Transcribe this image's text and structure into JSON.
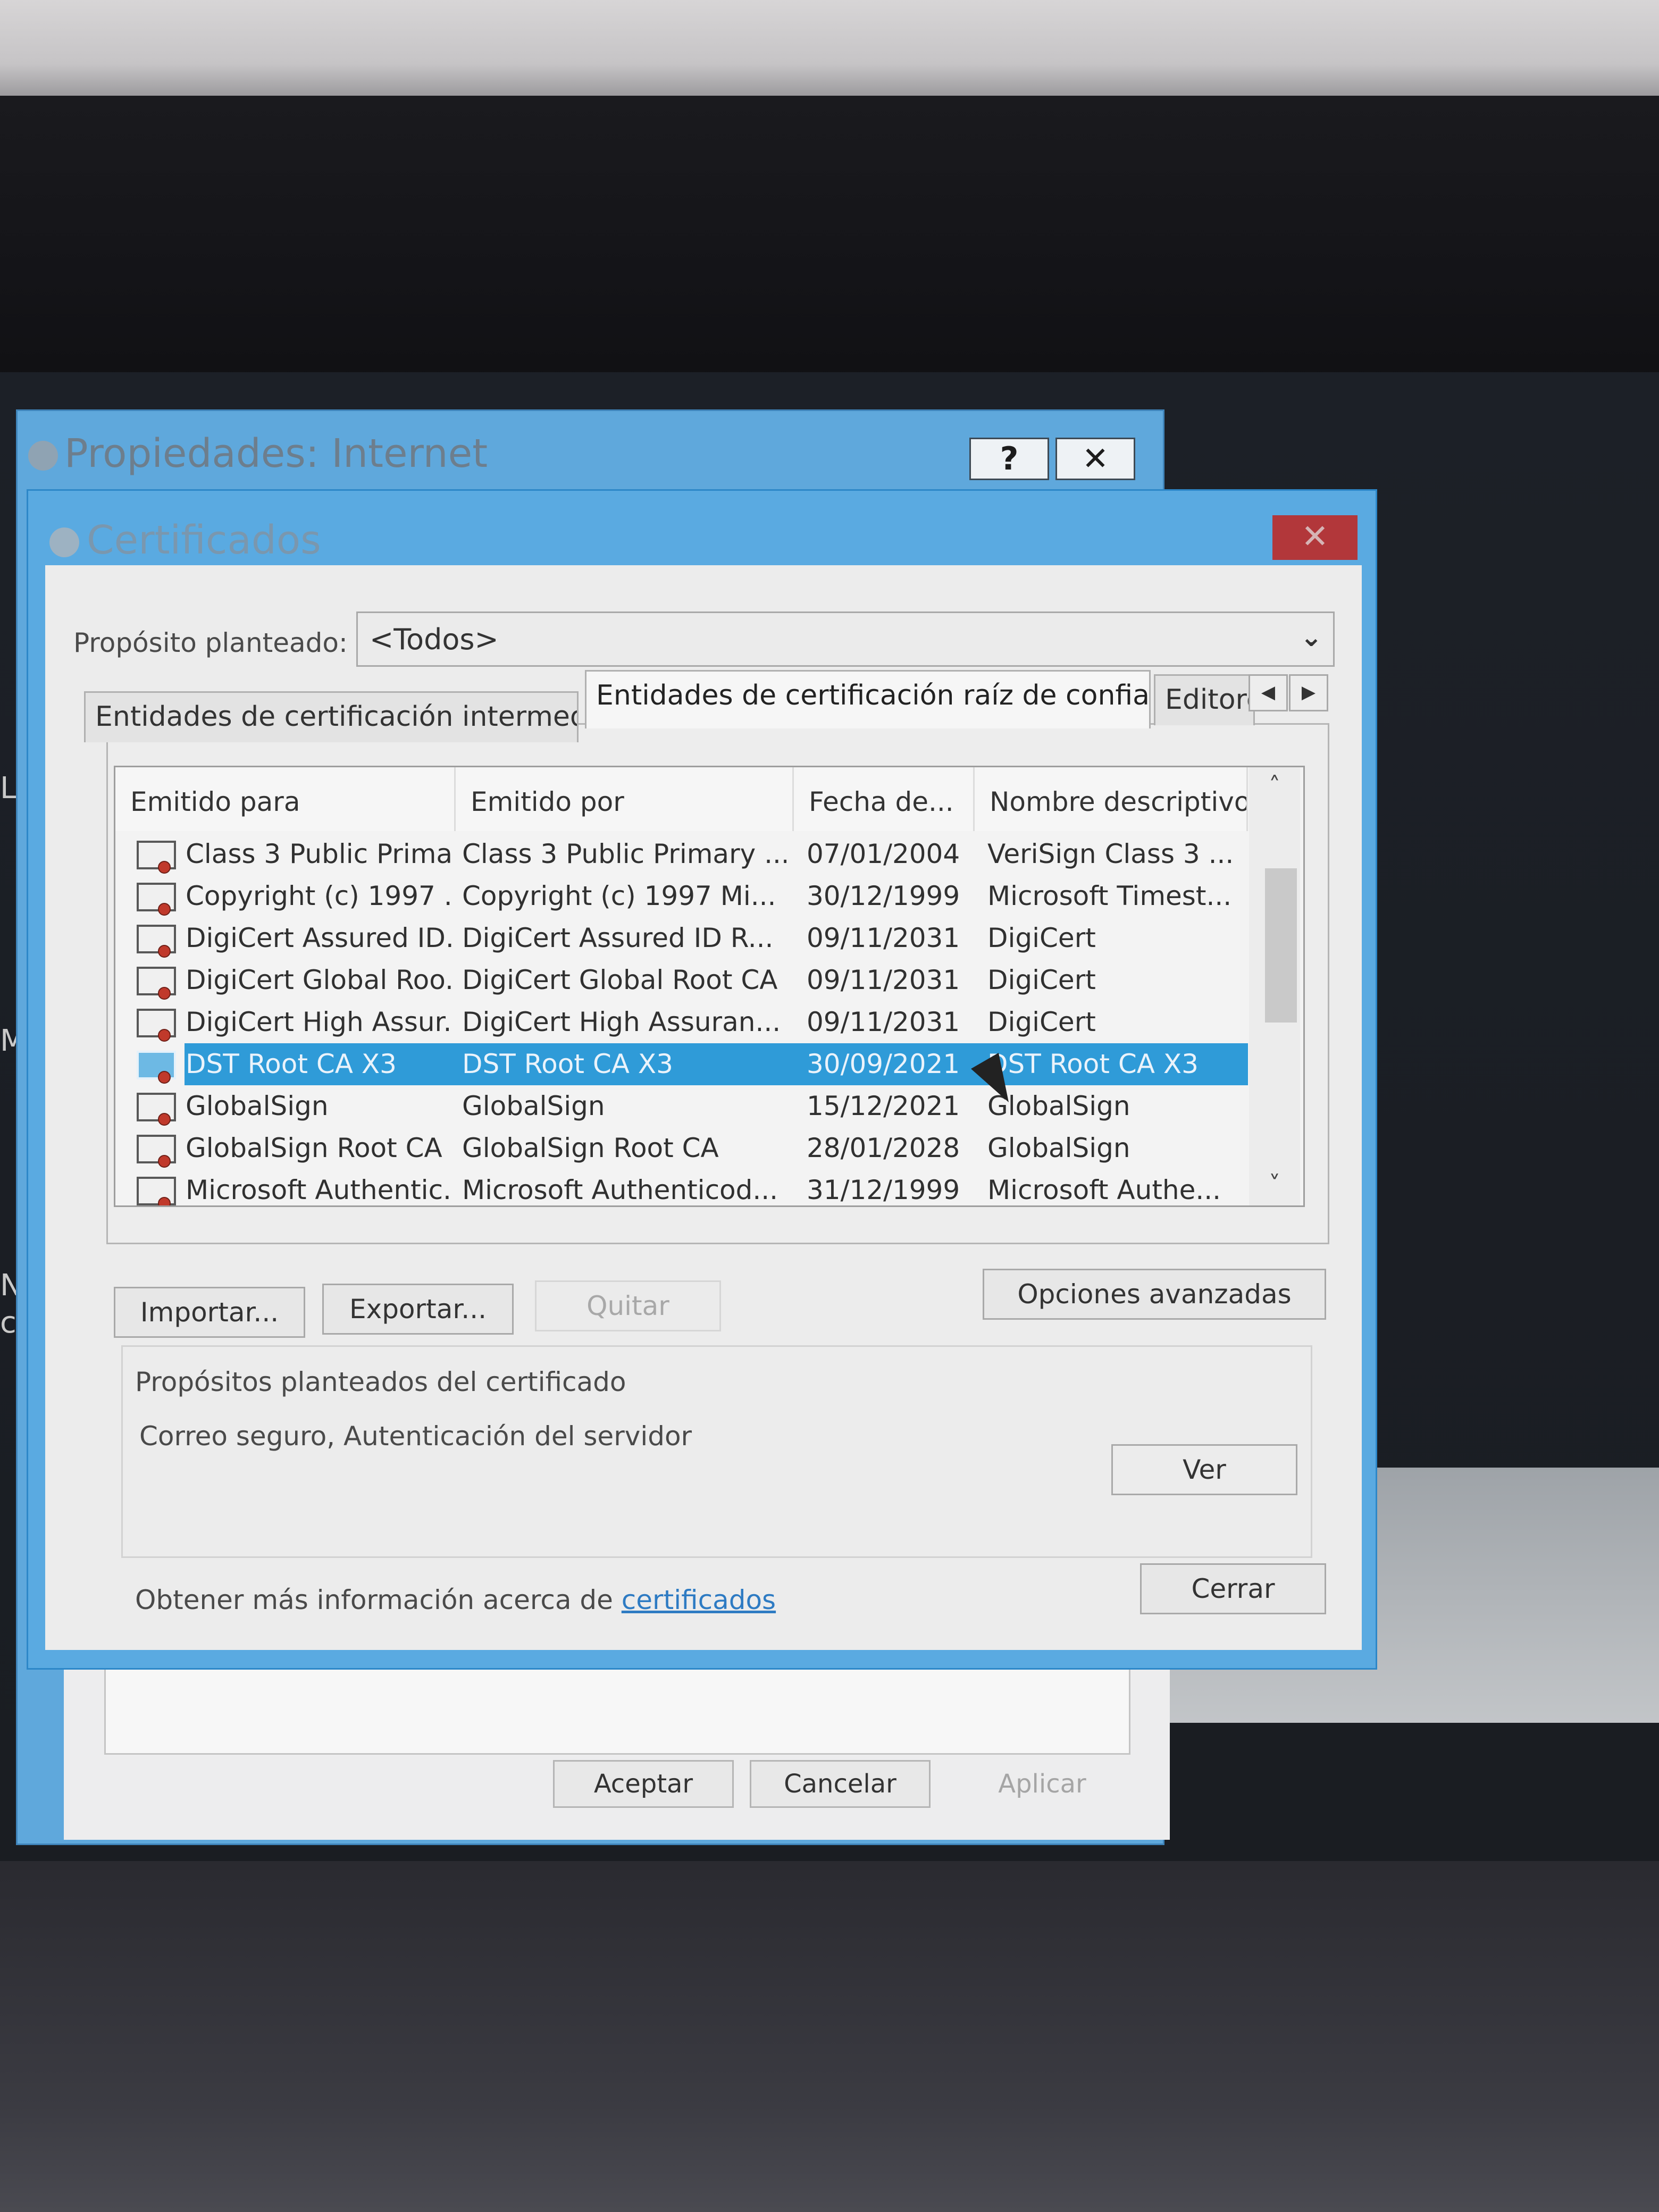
{
  "back_window": {
    "title": "Propiedades: Internet",
    "help_label": "?",
    "close_label": "✕",
    "ok_label": "Aceptar",
    "cancel_label": "Cancelar",
    "apply_label": "Aplicar"
  },
  "side_text": [
    "L",
    "M",
    "Na",
    "cor"
  ],
  "dialog": {
    "title": "Certificados",
    "close_label": "✕",
    "purpose_label": "Propósito planteado:",
    "purpose_value": "<Todos>",
    "tabs": [
      {
        "label": "Entidades de certificación intermedias",
        "active": false
      },
      {
        "label": "Entidades de certificación raíz de confianza",
        "active": true
      },
      {
        "label": "Editores",
        "active": false
      }
    ],
    "columns": [
      "Emitido para",
      "Emitido por",
      "Fecha de...",
      "Nombre descriptivo"
    ],
    "rows": [
      {
        "issued_to": "Class 3 Public Prima...",
        "issued_by": "Class 3 Public Primary ...",
        "date": "07/01/2004",
        "friendly": "VeriSign Class 3 ...",
        "selected": false
      },
      {
        "issued_to": "Copyright (c) 1997 ...",
        "issued_by": "Copyright (c) 1997 Mi...",
        "date": "30/12/1999",
        "friendly": "Microsoft Timest...",
        "selected": false
      },
      {
        "issued_to": "DigiCert Assured ID...",
        "issued_by": "DigiCert Assured ID R...",
        "date": "09/11/2031",
        "friendly": "DigiCert",
        "selected": false
      },
      {
        "issued_to": "DigiCert Global Roo...",
        "issued_by": "DigiCert Global Root CA",
        "date": "09/11/2031",
        "friendly": "DigiCert",
        "selected": false
      },
      {
        "issued_to": "DigiCert High Assur...",
        "issued_by": "DigiCert High Assuran...",
        "date": "09/11/2031",
        "friendly": "DigiCert",
        "selected": false
      },
      {
        "issued_to": "DST Root CA X3",
        "issued_by": "DST Root CA X3",
        "date": "30/09/2021",
        "friendly": "DST Root CA X3",
        "selected": true
      },
      {
        "issued_to": "GlobalSign",
        "issued_by": "GlobalSign",
        "date": "15/12/2021",
        "friendly": "GlobalSign",
        "selected": false
      },
      {
        "issued_to": "GlobalSign Root CA",
        "issued_by": "GlobalSign Root CA",
        "date": "28/01/2028",
        "friendly": "GlobalSign",
        "selected": false
      },
      {
        "issued_to": "Microsoft Authentic...",
        "issued_by": "Microsoft Authenticod...",
        "date": "31/12/1999",
        "friendly": "Microsoft Authe...",
        "selected": false
      }
    ],
    "import_label": "Importar...",
    "export_label": "Exportar...",
    "remove_label": "Quitar",
    "advanced_label": "Opciones avanzadas",
    "purposes_title": "Propósitos planteados del certificado",
    "purposes_value": "Correo seguro, Autenticación del servidor",
    "view_label": "Ver",
    "more_info_prefix": "Obtener más información acerca de ",
    "more_info_link": "certificados",
    "close_button_label": "Cerrar"
  }
}
